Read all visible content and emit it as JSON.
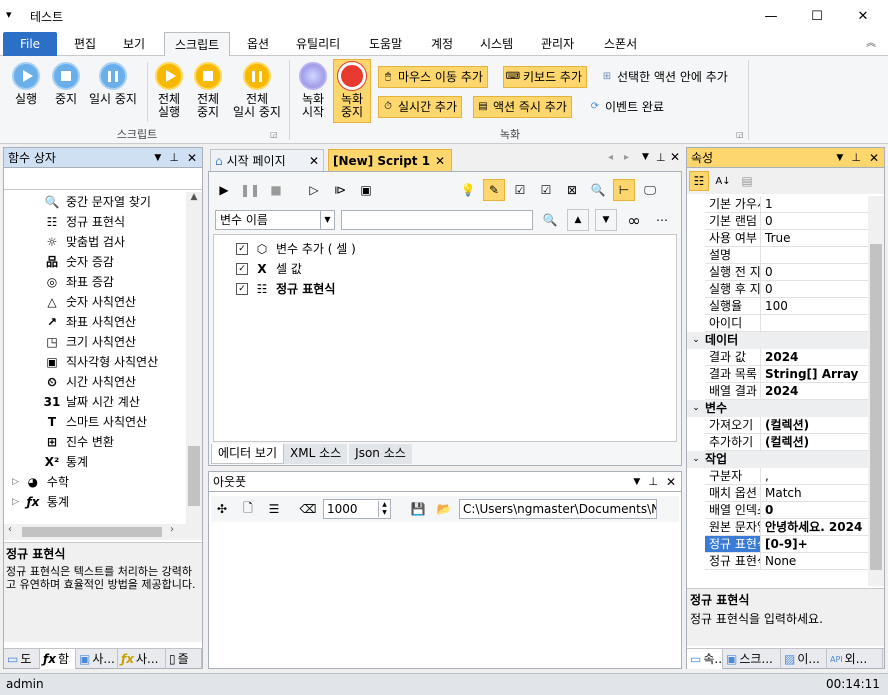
{
  "window": {
    "title": "테스트",
    "menu_glyph": "▾"
  },
  "window_controls": {
    "minimize": "—",
    "maximize": "☐",
    "close": "✕"
  },
  "menu": {
    "file": "File",
    "tabs": [
      "편집",
      "보기",
      "스크립트",
      "옵션",
      "유틸리티",
      "도움말",
      "계정",
      "시스템",
      "관리자",
      "스폰서"
    ],
    "collapse": "︽"
  },
  "ribbon": {
    "script_group": {
      "label": "스크립트",
      "buttons": [
        {
          "label": "실행",
          "label2": ""
        },
        {
          "label": "중지",
          "label2": ""
        },
        {
          "label": "일시 중지",
          "label2": ""
        },
        {
          "label": "전체",
          "label2": "실행"
        },
        {
          "label": "전체",
          "label2": "중지"
        },
        {
          "label": "전체",
          "label2": "일시 중지"
        }
      ]
    },
    "record_group": {
      "label": "녹화",
      "start": {
        "label": "녹화",
        "label2": "시작"
      },
      "stop": {
        "label": "녹화",
        "label2": "중지"
      },
      "small": [
        "마우스 이동 추가",
        "키보드 추가",
        "선택한 액션 안에 추가",
        "실시간 추가",
        "액션 즉시 추가",
        "이벤트 완료"
      ]
    }
  },
  "left_panel": {
    "title": "함수 상자",
    "items": [
      {
        "icon": "search-icon",
        "glyph": "🔍",
        "label": "중간 문자열 찾기"
      },
      {
        "icon": "regex-icon",
        "glyph": "☷",
        "label": "정규 표현식"
      },
      {
        "icon": "spellcheck-icon",
        "glyph": "☼",
        "label": "맞춤법 검사"
      },
      {
        "icon": "number-increase-icon",
        "glyph": "品",
        "label": "숫자 증감"
      },
      {
        "icon": "coordinate-increase-icon",
        "glyph": "◎",
        "label": "좌표 증감"
      },
      {
        "icon": "number-arith-icon",
        "glyph": "△",
        "label": "숫자 사칙연산"
      },
      {
        "icon": "coordinate-arith-icon",
        "glyph": "↗",
        "label": "좌표 사칙연산"
      },
      {
        "icon": "size-arith-icon",
        "glyph": "◳",
        "label": "크기 사칙연산"
      },
      {
        "icon": "rectangle-arith-icon",
        "glyph": "▣",
        "label": "직사각형 사칙연산"
      },
      {
        "icon": "time-arith-icon",
        "glyph": "⏲",
        "label": "시간 사칙연산"
      },
      {
        "icon": "calendar-icon",
        "glyph": "31",
        "label": "날짜 시간 계산"
      },
      {
        "icon": "text-icon",
        "glyph": "T",
        "label": "스마트 사칙연산"
      },
      {
        "icon": "base-convert-icon",
        "glyph": "⊞",
        "label": "진수 변환"
      },
      {
        "icon": "statistics-icon",
        "glyph": "X²",
        "label": "통계"
      }
    ],
    "groups": [
      {
        "icon": "pie-icon",
        "glyph": "◕",
        "label": "수학"
      },
      {
        "icon": "function-icon",
        "glyph": "ƒx",
        "label": "통계"
      }
    ],
    "desc_title": "정규 표현식",
    "desc_text": "정규 표현식은 텍스트를 처리하는 강력하고 유연하며 효율적인 방법을 제공합니다.",
    "bottom_tabs": [
      "도",
      "함",
      "사...",
      "사...",
      "즐"
    ]
  },
  "doc_tabs": {
    "start": "시작 페이지",
    "script": "[New] Script 1"
  },
  "editor": {
    "var_select": "변수 이름",
    "search_value": "",
    "tree": [
      {
        "label": "변수 추가 ( 셀 )",
        "bold": false
      },
      {
        "label": "셀 값",
        "bold": false
      },
      {
        "label": "정규 표현식",
        "bold": true
      }
    ],
    "view_tabs": [
      "에디터 보기",
      "XML 소스",
      "Json 소스"
    ]
  },
  "output": {
    "title": "아웃풋",
    "count": "1000",
    "path": "C:\\Users\\ngmaster\\Documents\\NGM"
  },
  "properties": {
    "title": "속성",
    "rows_top": [
      {
        "k": "기본 가우시",
        "v": "1"
      },
      {
        "k": "기본 랜덤",
        "v": "0"
      },
      {
        "k": "사용 여부",
        "v": "True"
      },
      {
        "k": "설명",
        "v": ""
      },
      {
        "k": "실행 전 지",
        "v": "0"
      },
      {
        "k": "실행 후 지",
        "v": "0"
      },
      {
        "k": "실행율",
        "v": "100"
      },
      {
        "k": "아이디",
        "v": ""
      }
    ],
    "cat_data": "데이터",
    "rows_data": [
      {
        "k": "결과 값",
        "v": "2024"
      },
      {
        "k": "결과 목록",
        "v": "String[] Array"
      },
      {
        "k": "배열 결과",
        "v": "2024"
      }
    ],
    "cat_var": "변수",
    "rows_var": [
      {
        "k": "가져오기",
        "v": "(컬렉션)"
      },
      {
        "k": "추가하기",
        "v": "(컬렉션)"
      }
    ],
    "cat_work": "작업",
    "rows_work": [
      {
        "k": "구분자",
        "v": ","
      },
      {
        "k": "매치 옵션",
        "v": "Match"
      },
      {
        "k": "배열 인덱스",
        "v": "0"
      },
      {
        "k": "원본 문자열",
        "v": "안녕하세요. 2024"
      },
      {
        "k": "정규 표현식",
        "v": "[0-9]+"
      },
      {
        "k": "정규 표현식",
        "v": "None"
      }
    ],
    "desc_title": "정규 표현식",
    "desc_text": "정규 표현식을 입력하세요.",
    "bottom_tabs": [
      "속...",
      "스크...",
      "이...",
      "외..."
    ]
  },
  "status": {
    "user": "admin",
    "time": "00:14:11"
  }
}
